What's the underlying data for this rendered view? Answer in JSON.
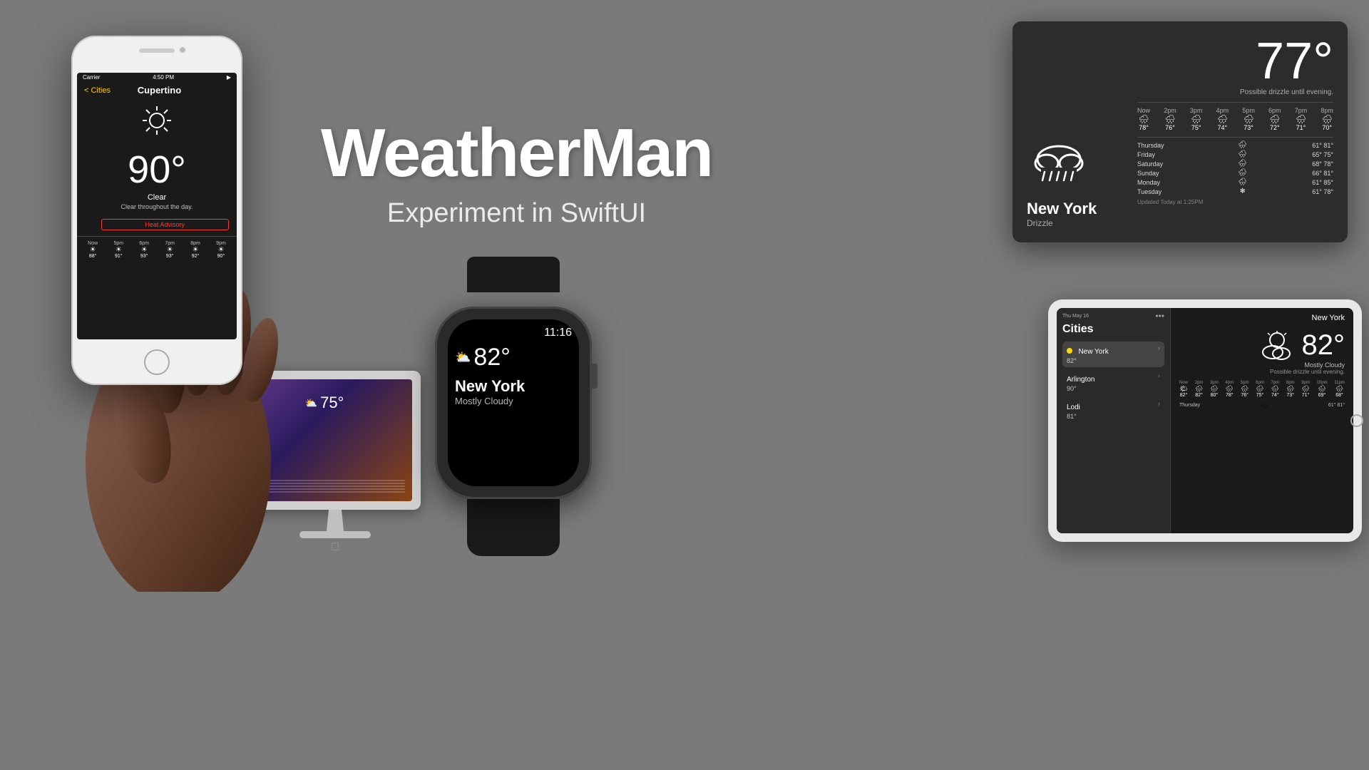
{
  "app": {
    "title": "WeatherMan",
    "subtitle": "Experiment in SwiftUI",
    "background": "#7a7a7a"
  },
  "iphone": {
    "status": {
      "carrier": "Carrier",
      "time": "4:50 PM",
      "signal": "●●●"
    },
    "nav_back": "< Cities",
    "city": "Cupertino",
    "temperature": "90°",
    "condition": "Clear",
    "description": "Clear throughout the day.",
    "advisory": "Heat Advisory",
    "hourly": [
      {
        "label": "Now",
        "icon": "☀",
        "temp": "88°"
      },
      {
        "label": "5pm",
        "icon": "☀",
        "temp": "91°"
      },
      {
        "label": "6pm",
        "icon": "☀",
        "temp": "93°"
      },
      {
        "label": "7pm",
        "icon": "☀",
        "temp": "93°"
      },
      {
        "label": "8pm",
        "icon": "☀",
        "temp": "92°"
      },
      {
        "label": "9pm",
        "icon": "☀",
        "temp": "90°"
      }
    ]
  },
  "watch": {
    "time": "11:16",
    "weather_icon": "⛅",
    "temperature": "82°",
    "city": "New York",
    "condition": "Mostly Cloudy"
  },
  "tv": {
    "temperature_big": "77°",
    "possible_text": "Possible drizzle until evening.",
    "city": "New York",
    "condition": "Drizzle",
    "hourly": [
      {
        "label": "Now",
        "icon": "🌧",
        "temp": "78°"
      },
      {
        "label": "2pm",
        "icon": "🌧",
        "temp": "76°"
      },
      {
        "label": "3pm",
        "icon": "🌧",
        "temp": "75°"
      },
      {
        "label": "4pm",
        "icon": "🌧",
        "temp": "74°"
      },
      {
        "label": "5pm",
        "icon": "🌧",
        "temp": "73°"
      },
      {
        "label": "6pm",
        "icon": "🌧",
        "temp": "72°"
      },
      {
        "label": "7pm",
        "icon": "🌧",
        "temp": "71°"
      },
      {
        "label": "8pm",
        "icon": "🌧",
        "temp": "70°"
      }
    ],
    "weekly": [
      {
        "day": "Thursday",
        "icon": "🌧",
        "temps": "61° 81°"
      },
      {
        "day": "Friday",
        "icon": "🌧",
        "temps": "65° 75°"
      },
      {
        "day": "Saturday",
        "icon": "🌧",
        "temps": "68° 78°"
      },
      {
        "day": "Sunday",
        "icon": "🌧",
        "temps": "66° 81°"
      },
      {
        "day": "Monday",
        "icon": "🌧",
        "temps": "61° 85°"
      },
      {
        "day": "Tuesday",
        "icon": "❄",
        "temps": "61° 78°"
      }
    ],
    "updated": "Updated Today at 1:25PM"
  },
  "ipad": {
    "cities_header": "Cities",
    "ny_label": "New York",
    "right_city": "New York",
    "cities": [
      {
        "name": "New York",
        "temp": "82°",
        "active": true,
        "dot": true
      },
      {
        "name": "Arlington",
        "temp": "90°",
        "active": false,
        "dot": false
      },
      {
        "name": "Lodi",
        "temp": "81°",
        "active": false,
        "dot": false
      }
    ],
    "temperature": "82°",
    "condition": "Mostly Cloudy",
    "condition_sub": "Possible drizzle until evening.",
    "hourly": [
      {
        "label": "Now",
        "icon": "🌤",
        "temp": "82°"
      },
      {
        "label": "2pm",
        "icon": "🌧",
        "temp": "82°"
      },
      {
        "label": "3pm",
        "icon": "🌧",
        "temp": "80°"
      },
      {
        "label": "4pm",
        "icon": "🌧",
        "temp": "78°"
      },
      {
        "label": "5pm",
        "icon": "🌧",
        "temp": "76°"
      },
      {
        "label": "6pm",
        "icon": "🌧",
        "temp": "75°"
      },
      {
        "label": "7pm",
        "icon": "🌧",
        "temp": "74°"
      },
      {
        "label": "8pm",
        "icon": "🌧",
        "temp": "73°"
      },
      {
        "label": "9pm",
        "icon": "🌧",
        "temp": "71°"
      },
      {
        "label": "10pm",
        "icon": "🌧",
        "temp": "69°"
      },
      {
        "label": "11pm",
        "icon": "🌧",
        "temp": "68°"
      }
    ],
    "weekly": [
      {
        "day": "Thursday",
        "icon": "🌧",
        "temps": "61° 81°"
      }
    ]
  },
  "imac": {
    "temperature": "75°",
    "icon": "⛅"
  }
}
